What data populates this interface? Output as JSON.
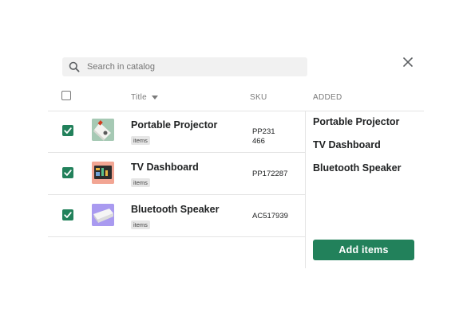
{
  "search": {
    "placeholder": "Search in catalog"
  },
  "columns": {
    "title": "Title",
    "sku": "SKU",
    "added": "ADDED"
  },
  "products": [
    {
      "name": "Portable Projector",
      "badge": "items",
      "sku": "PP231\n466",
      "checked": true,
      "thumb_icon": "projector-image"
    },
    {
      "name": "TV Dashboard",
      "badge": "items",
      "sku": "PP172287",
      "checked": true,
      "thumb_icon": "tv-dashboard-image"
    },
    {
      "name": "Bluetooth Speaker",
      "badge": "items",
      "sku": "AC517939",
      "checked": true,
      "thumb_icon": "speaker-image"
    }
  ],
  "added": [
    "Portable Projector",
    "TV Dashboard",
    "Bluetooth Speaker"
  ],
  "actions": {
    "add_label": "Add items"
  },
  "colors": {
    "accent": "#22815b",
    "thumb_projector_bg": "#a6c9b4",
    "thumb_tv_bg": "#f2a593",
    "thumb_speaker_bg": "#a99af0"
  }
}
